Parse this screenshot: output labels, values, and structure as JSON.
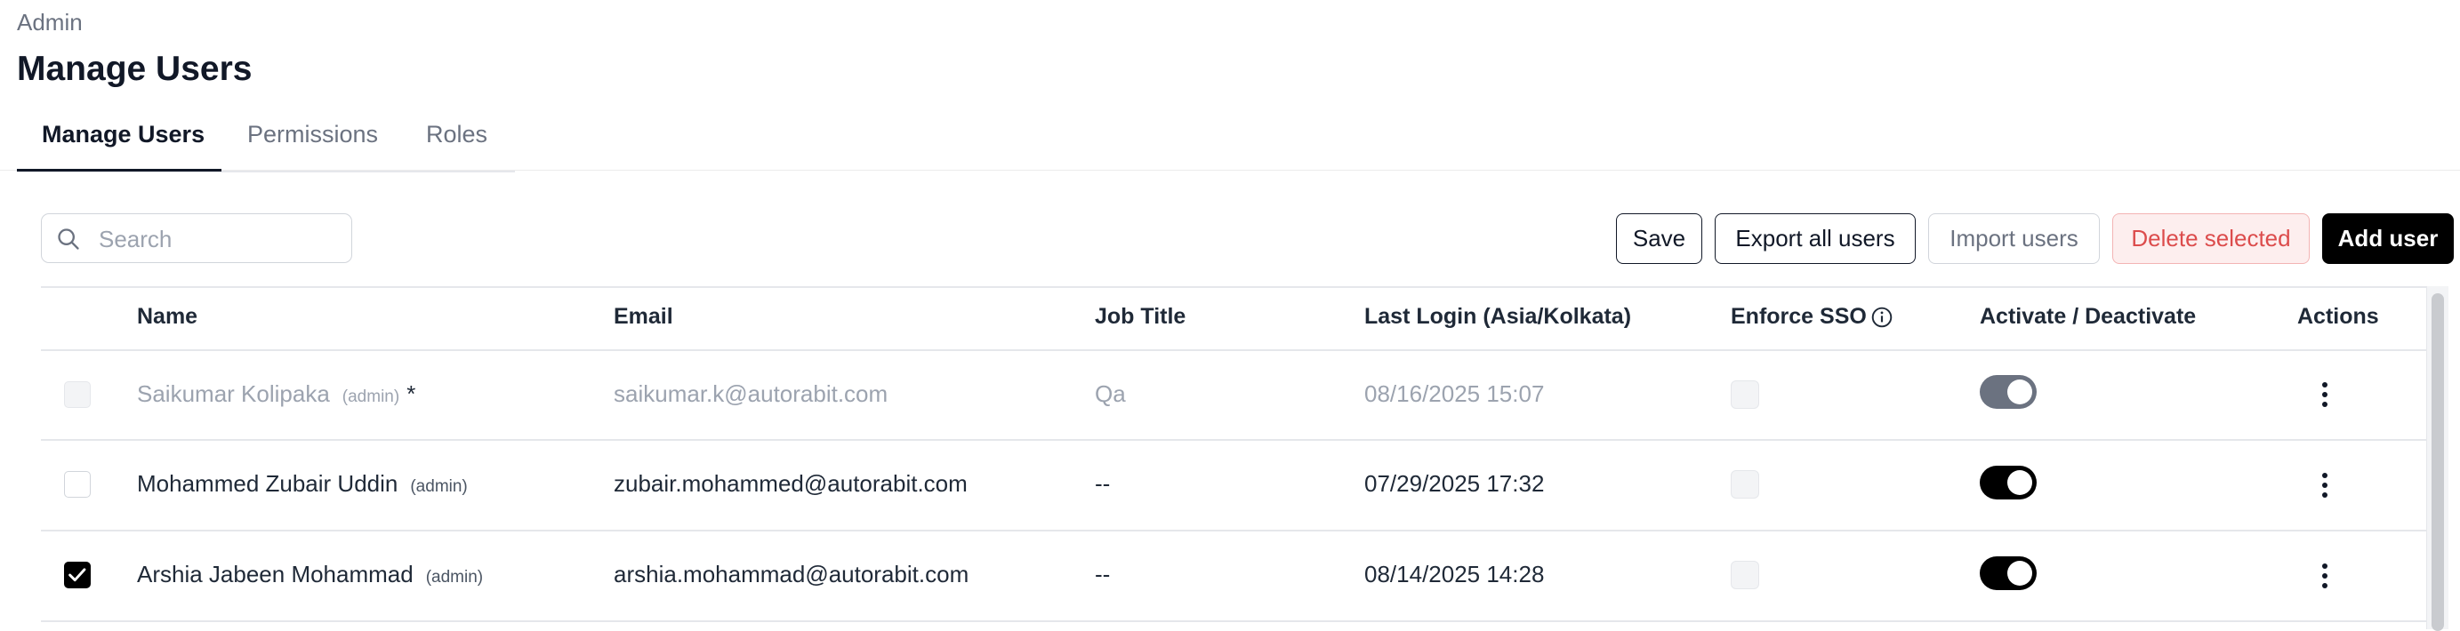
{
  "breadcrumb": "Admin",
  "title": "Manage Users",
  "tabs": [
    {
      "label": "Manage Users",
      "active": true
    },
    {
      "label": "Permissions",
      "active": false
    },
    {
      "label": "Roles",
      "active": false
    }
  ],
  "search": {
    "placeholder": "Search",
    "value": ""
  },
  "toolbar": {
    "save_label": "Save",
    "export_label": "Export all users",
    "import_label": "Import users",
    "delete_label": "Delete selected",
    "add_label": "Add user"
  },
  "table": {
    "columns": {
      "name": "Name",
      "email": "Email",
      "job_title": "Job Title",
      "last_login": "Last Login (Asia/Kolkata)",
      "enforce_sso": "Enforce SSO",
      "activate": "Activate / Deactivate",
      "actions": "Actions"
    },
    "rows": [
      {
        "name": "Saikumar Kolipaka",
        "role_tag": "(admin)",
        "marker": "*",
        "email": "saikumar.k@autorabit.com",
        "job_title": "Qa",
        "last_login": "08/16/2025 15:07",
        "selected": false,
        "selectable": false,
        "sso": false,
        "active": true,
        "toggle_disabled": true
      },
      {
        "name": "Mohammed Zubair Uddin",
        "role_tag": "(admin)",
        "email": "zubair.mohammed@autorabit.com",
        "job_title": "--",
        "last_login": "07/29/2025 17:32",
        "selected": false,
        "selectable": true,
        "sso": false,
        "active": true,
        "toggle_disabled": false
      },
      {
        "name": "Arshia Jabeen Mohammad",
        "role_tag": "(admin)",
        "email": "arshia.mohammad@autorabit.com",
        "job_title": "--",
        "last_login": "08/14/2025 14:28",
        "selected": true,
        "selectable": true,
        "sso": false,
        "active": true,
        "toggle_disabled": false
      }
    ]
  },
  "icons": {
    "search": "search-icon",
    "info": "info-icon",
    "kebab": "kebab-menu-icon",
    "check": "check-icon"
  },
  "colors": {
    "primary": "#000000",
    "danger": "#dc4c4c",
    "danger_bg": "#fdeeee",
    "muted_text": "#9ca3af"
  }
}
